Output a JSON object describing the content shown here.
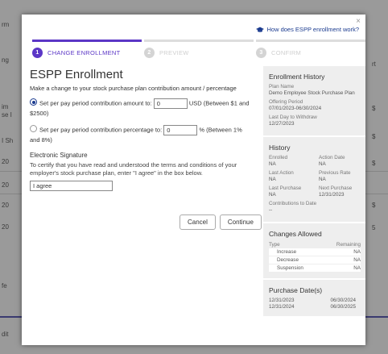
{
  "background": {
    "left_fragments": [
      "rm",
      "ng",
      "im",
      "se I",
      "I Sh",
      "20",
      "20",
      "20",
      "20",
      "fe",
      "dit"
    ],
    "right_fragments": [
      "rt",
      "$",
      "$",
      "$",
      "$",
      "5"
    ]
  },
  "header": {
    "close_label": "×",
    "help_link": "How does ESPP enrollment work?"
  },
  "steps": [
    {
      "number": "1",
      "label": "CHANGE ENROLLMENT",
      "state": "active"
    },
    {
      "number": "2",
      "label": "PREVIEW",
      "state": "inactive"
    },
    {
      "number": "3",
      "label": "CONFIRM",
      "state": "inactive"
    }
  ],
  "main": {
    "title": "ESPP Enrollment",
    "subtitle": "Make a change to your stock purchase plan contribution amount / percentage",
    "option_amount": {
      "label_pre": "Set per pay period contribution amount to:",
      "value": "0",
      "label_post": "USD (Between $1 and $2500)",
      "selected": true
    },
    "option_percentage": {
      "label_pre": "Set per pay period contribution percentage to:",
      "value": "0",
      "label_post": "% (Between 1% and 8%)",
      "selected": false
    },
    "signature_heading": "Electronic Signature",
    "signature_text": "To certify that you have read and understood the terms and conditions of your employer's stock purchase plan, enter \"I agree\" in the box below.",
    "signature_value": "I agree",
    "cancel_label": "Cancel",
    "continue_label": "Continue"
  },
  "sidebar": {
    "enrollment_history": {
      "heading": "Enrollment History",
      "plan_name_label": "Plan Name",
      "plan_name": "Demo Employee Stock Purchase Plan",
      "offering_period_label": "Offering Period",
      "offering_period": "07/01/2023-06/30/2024",
      "last_day_label": "Last Day to Withdraw",
      "last_day": "12/27/2023"
    },
    "history": {
      "heading": "History",
      "enrolled_label": "Enrolled",
      "enrolled": "NA",
      "action_date_label": "Action Date",
      "action_date": "NA",
      "last_action_label": "Last Action",
      "last_action": "NA",
      "previous_rate_label": "Previous Rate",
      "previous_rate": "NA",
      "last_purchase_label": "Last Purchase",
      "last_purchase": "NA",
      "next_purchase_label": "Next Purchase",
      "next_purchase": "12/31/2023",
      "contributions_label": "Contributions to Date",
      "contributions": "--"
    },
    "changes_allowed": {
      "heading": "Changes Allowed",
      "col_type": "Type",
      "col_remaining": "Remaining",
      "rows": [
        {
          "type": "Increase",
          "remaining": "NA"
        },
        {
          "type": "Decrease",
          "remaining": "NA"
        },
        {
          "type": "Suspension",
          "remaining": "NA"
        }
      ]
    },
    "purchase_dates": {
      "heading": "Purchase Date(s)",
      "rows": [
        {
          "a": "12/31/2023",
          "b": "06/30/2024"
        },
        {
          "a": "12/31/2024",
          "b": "06/30/2025"
        }
      ]
    }
  },
  "colors": {
    "accent": "#5b36c6",
    "link": "#1b3b8f",
    "panel": "#eeeeee"
  }
}
